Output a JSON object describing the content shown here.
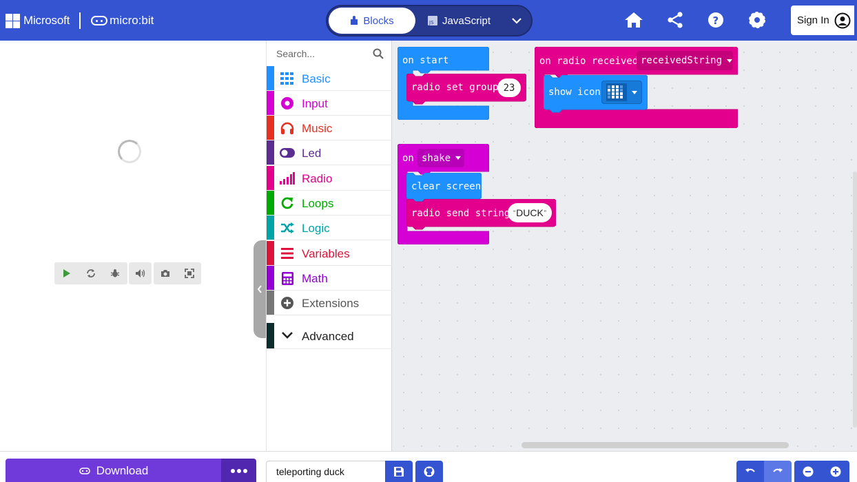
{
  "header": {
    "brand_microsoft": "Microsoft",
    "brand_microbit": "micro:bit",
    "blocks_label": "Blocks",
    "javascript_label": "JavaScript",
    "signin_label": "Sign In",
    "icons": [
      "home-icon",
      "share-icon",
      "help-icon",
      "gear-icon",
      "user-icon"
    ],
    "accent_color": "#3454d1"
  },
  "simulator": {
    "controls": [
      "play-icon",
      "restart-icon",
      "debug-icon",
      "sound-icon",
      "screenshot-icon",
      "fullscreen-icon"
    ]
  },
  "toolbox": {
    "search_placeholder": "Search...",
    "categories": [
      {
        "label": "Basic",
        "color": "#1e90ff",
        "icon": "grid-icon"
      },
      {
        "label": "Input",
        "color": "#d400d4",
        "icon": "circle-icon"
      },
      {
        "label": "Music",
        "color": "#e63022",
        "icon": "headphones-icon"
      },
      {
        "label": "Led",
        "color": "#5c2d91",
        "icon": "toggle-icon"
      },
      {
        "label": "Radio",
        "color": "#e3008c",
        "icon": "signal-icon"
      },
      {
        "label": "Loops",
        "color": "#00aa00",
        "icon": "loop-icon"
      },
      {
        "label": "Logic",
        "color": "#00a4a6",
        "icon": "shuffle-icon"
      },
      {
        "label": "Variables",
        "color": "#dc143c",
        "icon": "lines-icon"
      },
      {
        "label": "Math",
        "color": "#9400d3",
        "icon": "calculator-icon"
      },
      {
        "label": "Extensions",
        "color": "#767676",
        "icon": "plus-circle-icon"
      },
      {
        "label": "Advanced",
        "color": "#222222",
        "icon": "chevron-down-icon"
      }
    ]
  },
  "workspace": {
    "on_start": {
      "label": "on start",
      "color": "#1e90ff"
    },
    "radio_set_group": {
      "label": "radio set group",
      "value": "23",
      "color": "#e3008c"
    },
    "on_radio_received": {
      "label": "on radio received",
      "variable": "receivedString",
      "color": "#e3008c"
    },
    "show_icon": {
      "label": "show icon",
      "color": "#1e90ff"
    },
    "on_shake": {
      "label": "on",
      "gesture": "shake",
      "color": "#d400d4"
    },
    "clear_screen": {
      "label": "clear screen",
      "color": "#1e90ff"
    },
    "radio_send_string": {
      "label": "radio send string",
      "value": "DUCK",
      "color": "#e3008c"
    }
  },
  "footer": {
    "download_label": "Download",
    "project_name": "teleporting duck"
  }
}
